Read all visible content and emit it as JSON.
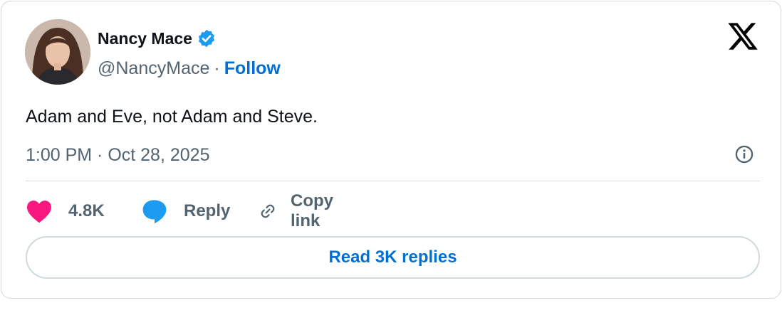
{
  "author": {
    "name": "Nancy Mace",
    "handle": "@NancyMace",
    "separator": "·",
    "follow_label": "Follow",
    "verified": true
  },
  "tweet": {
    "text": "Adam and Eve, not Adam and Steve.",
    "timestamp": "1:00 PM · Oct 28, 2025"
  },
  "actions": {
    "like_count": "4.8K",
    "reply_label": "Reply",
    "copy_link_label": "Copy link"
  },
  "read_replies_label": "Read 3K replies",
  "icons": {
    "logo": "x-logo-icon",
    "verified": "verified-badge-icon",
    "info": "info-icon",
    "like": "heart-icon",
    "reply": "speech-bubble-icon",
    "copy": "link-icon"
  },
  "colors": {
    "accent": "#006fd6",
    "heart": "#f91880",
    "reply_bubble": "#1d9bf0",
    "verified": "#1d9bf0",
    "secondary_text": "#536471",
    "border": "#cfd9de"
  }
}
